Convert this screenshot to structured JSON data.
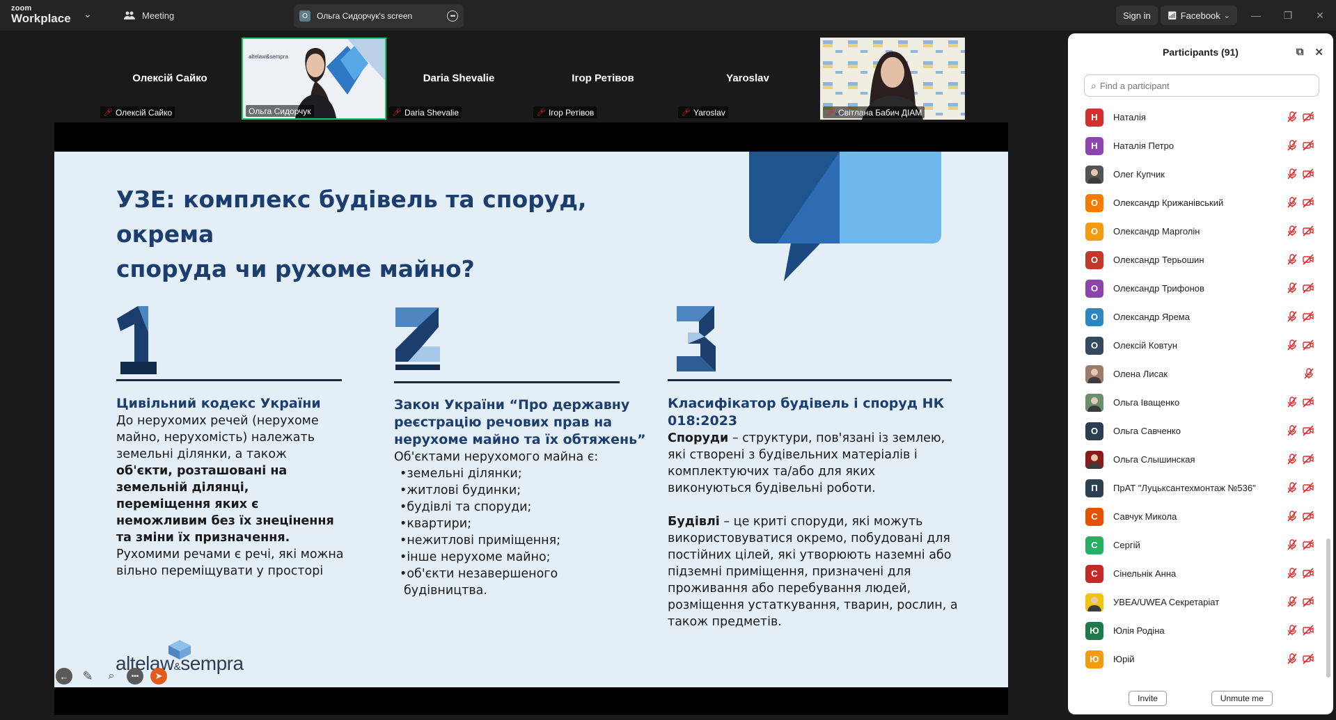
{
  "titlebar": {
    "logo_top": "zoom",
    "logo_bottom": "Workplace",
    "meeting_tab": "Meeting",
    "screen_tab_avatar": "О",
    "screen_tab": "Ольга Сидорчук's screen",
    "sign_in": "Sign in",
    "facebook": "Facebook",
    "accent": "#0b5cff"
  },
  "video_tiles": [
    {
      "big_name": "Олексій Сайко",
      "label": "Олексій Сайко",
      "video": false
    },
    {
      "big_name": "",
      "label": "Ольга Сидорчук",
      "video": true,
      "active": true
    },
    {
      "big_name": "Daria Shevalie",
      "label": "Daria Shevalie",
      "video": false
    },
    {
      "big_name": "Ігор Ретівов",
      "label": "Ігор Ретівов",
      "video": false
    },
    {
      "big_name": "Yaroslav",
      "label": "Yaroslav",
      "video": false
    },
    {
      "big_name": "",
      "label": "Світлана Бабич ДІАМ",
      "video": true
    }
  ],
  "slide": {
    "title": "УЗЕ: комплекс будівель та споруд, окрема\nспоруда чи рухоме майно?",
    "col1": {
      "number": "1",
      "head": "Цивільний кодекс України",
      "p1": "До нерухомих речей (нерухоме майно, нерухомість) належать земельні ділянки, а також ",
      "p1_bold": "об'єкти, розташовані на земельній ділянці, переміщення яких є неможливим без їх знецінення та зміни їх призначення.",
      "p2": "Рухомими речами є речі, які можна вільно переміщувати у просторі"
    },
    "col2": {
      "number": "2",
      "head": "Закон України “Про державну реєстрацію речових прав на нерухоме майно та їх обтяжень”",
      "intro": "Об'єктами нерухомого майна є:",
      "items": [
        "•земельні ділянки;",
        "•житлові будинки;",
        "•будівлі та споруди;",
        "•квартири;",
        "•нежитлові приміщення;",
        "•інше нерухоме майно;",
        "•об'єкти незавершеного",
        "будівництва."
      ]
    },
    "col3": {
      "number": "3",
      "head": "Класифікатор будівель і споруд НК 018:2023",
      "p1_bold": "Споруди",
      "p1": " – структури, пов'язані із землею, які створені з будівельних матеріалів і комплектуючих та/або для яких виконуються будівельні роботи.",
      "p2_bold": "Будівлі",
      "p2": " – це криті споруди, які можуть використовуватися окремо, побудовані для постійних цілей, які утворюють наземні або підземні приміщення, призначені для проживання або перебування людей, розміщення устаткування, тварин, рослин, а також предметів."
    },
    "logo_a": "altelaw",
    "logo_amp": "&",
    "logo_b": "sempra",
    "bg": "#e3eef6",
    "navy": "#1b3e6f"
  },
  "panel": {
    "title": "Participants (91)",
    "search_placeholder": "Find a participant",
    "participants": [
      {
        "initial": "Н",
        "name": "Наталія",
        "color": "#d32f2f",
        "video_off": true
      },
      {
        "initial": "Н",
        "name": "Наталія Петро",
        "color": "#8e44ad",
        "video_off": true
      },
      {
        "initial": "",
        "name": "Олег Купчик",
        "color": "#555555",
        "photo": true,
        "video_off": true
      },
      {
        "initial": "О",
        "name": "Олександр Крижанівський",
        "color": "#f57c00",
        "video_off": true
      },
      {
        "initial": "О",
        "name": "Олександр Марголін",
        "color": "#f39c12",
        "video_off": true
      },
      {
        "initial": "О",
        "name": "Олександр Терьошин",
        "color": "#c0392b",
        "video_off": true
      },
      {
        "initial": "О",
        "name": "Олександр Трифонов",
        "color": "#8e44ad",
        "video_off": true
      },
      {
        "initial": "О",
        "name": "Олександр Ярема",
        "color": "#2e86c1",
        "video_off": true
      },
      {
        "initial": "О",
        "name": "Олексій Ковтун",
        "color": "#34495e",
        "video_off": true
      },
      {
        "initial": "",
        "name": "Олена Лисак",
        "color": "#9c7b6b",
        "photo": true,
        "video_off": false
      },
      {
        "initial": "",
        "name": "Ольга Іващенко",
        "color": "#6b8e6b",
        "photo": true,
        "video_off": true
      },
      {
        "initial": "О",
        "name": "Ольга Савченко",
        "color": "#2c3e50",
        "video_off": true
      },
      {
        "initial": "",
        "name": "Ольга Слышинская",
        "color": "#8b1a1a",
        "photo": true,
        "video_off": true
      },
      {
        "initial": "П",
        "name": "ПрАТ \"Луцьксантехмонтаж №536\"",
        "color": "#2c3e50",
        "video_off": true
      },
      {
        "initial": "С",
        "name": "Савчук Микола",
        "color": "#e65100",
        "video_off": true
      },
      {
        "initial": "С",
        "name": "Сергій",
        "color": "#27ae60",
        "video_off": true
      },
      {
        "initial": "С",
        "name": "Сінельнік Анна",
        "color": "#c62828",
        "video_off": true
      },
      {
        "initial": "",
        "name": "УВЕА/UWEA Секретаріат",
        "color": "#f1c40f",
        "photo": true,
        "video_off": true
      },
      {
        "initial": "Ю",
        "name": "Юлія Родіна",
        "color": "#1e7a4a",
        "video_off": true
      },
      {
        "initial": "Ю",
        "name": "Юрій",
        "color": "#f39c12",
        "video_off": true
      }
    ],
    "invite": "Invite",
    "unmute": "Unmute me",
    "muted_color": "#e02828"
  }
}
